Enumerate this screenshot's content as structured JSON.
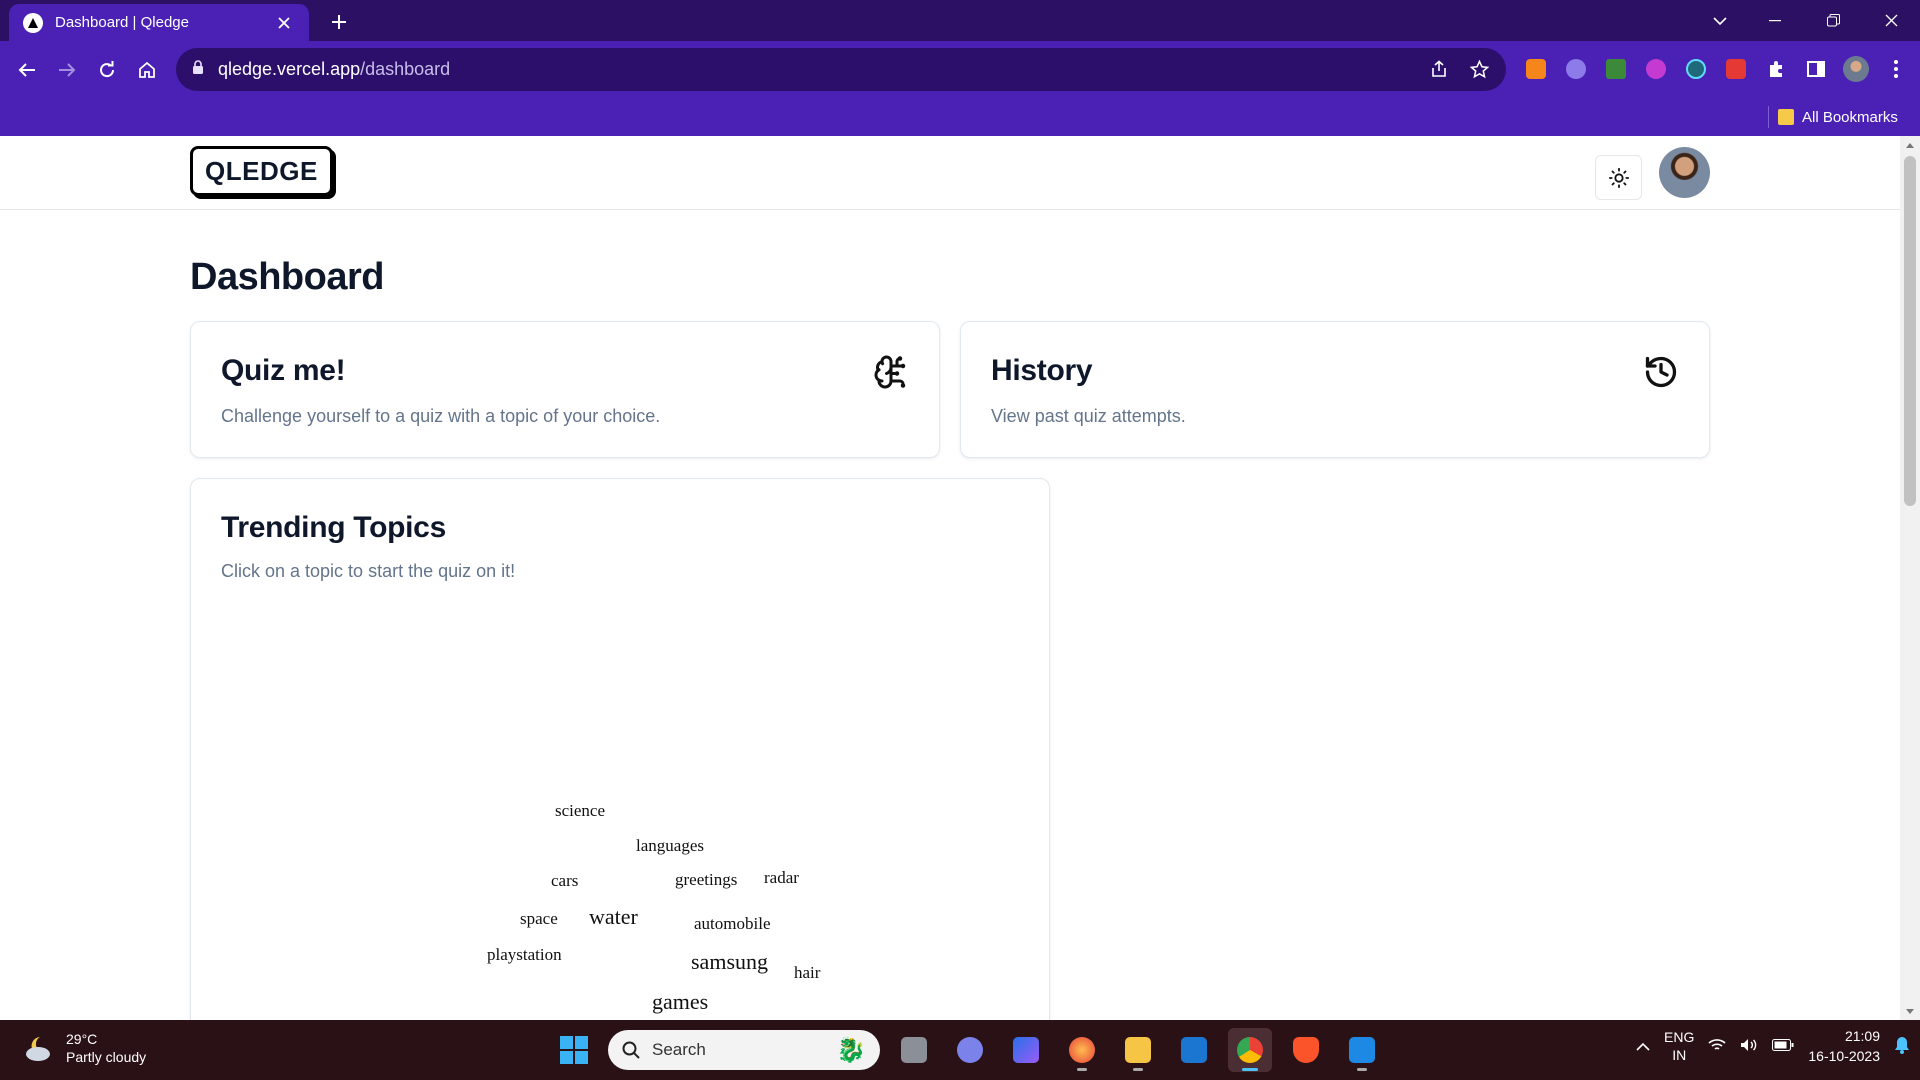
{
  "browser": {
    "tab_title": "Dashboard | Qledge",
    "url_domain": "qledge.vercel.app",
    "url_path": "/dashboard",
    "bookmark_folder": "All Bookmarks"
  },
  "header": {
    "logo": "QLEDGE"
  },
  "dashboard": {
    "title": "Dashboard",
    "quiz_card": {
      "title": "Quiz me!",
      "description": "Challenge yourself to a quiz with a topic of your choice."
    },
    "history_card": {
      "title": "History",
      "description": "View past quiz attempts."
    },
    "trending": {
      "title": "Trending Topics",
      "description": "Click on a topic to start the quiz on it!",
      "words": [
        {
          "text": "science",
          "weight": 1
        },
        {
          "text": "languages",
          "weight": 1
        },
        {
          "text": "cars",
          "weight": 1
        },
        {
          "text": "greetings",
          "weight": 1
        },
        {
          "text": "radar",
          "weight": 1
        },
        {
          "text": "space",
          "weight": 1
        },
        {
          "text": "water",
          "weight": 2
        },
        {
          "text": "automobile",
          "weight": 1
        },
        {
          "text": "playstation",
          "weight": 1
        },
        {
          "text": "samsung",
          "weight": 2
        },
        {
          "text": "hair",
          "weight": 1
        },
        {
          "text": "games",
          "weight": 2
        }
      ]
    }
  },
  "taskbar": {
    "temperature": "29°C",
    "weather": "Partly cloudy",
    "search_placeholder": "Search",
    "language": "ENG",
    "region": "IN",
    "time": "21:09",
    "date": "16-10-2023"
  },
  "colors": {
    "browser_frame": "#4a20b5",
    "tab_strip": "#2b1063",
    "omnibox": "#2c0f6b",
    "muted_text": "#64748b",
    "taskbar": "#2a1116"
  }
}
